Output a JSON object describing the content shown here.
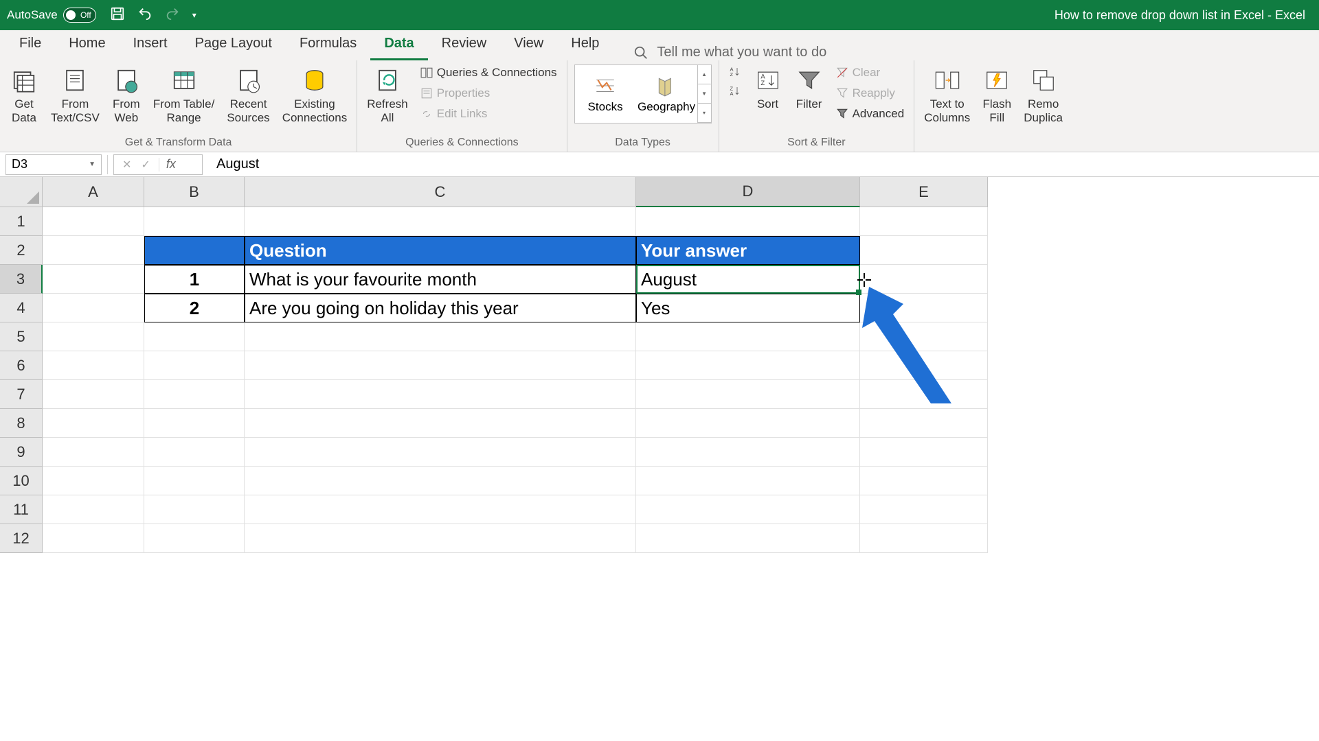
{
  "titlebar": {
    "autosave_label": "AutoSave",
    "autosave_state": "Off",
    "doc_title": "How to remove drop down list in Excel  -  Excel"
  },
  "tabs": {
    "file": "File",
    "home": "Home",
    "insert": "Insert",
    "page_layout": "Page Layout",
    "formulas": "Formulas",
    "data": "Data",
    "review": "Review",
    "view": "View",
    "help": "Help",
    "tellme": "Tell me what you want to do"
  },
  "ribbon": {
    "get_transform": {
      "label": "Get & Transform Data",
      "get_data": "Get\nData",
      "from_textcsv": "From\nText/CSV",
      "from_web": "From\nWeb",
      "from_table": "From Table/\nRange",
      "recent_sources": "Recent\nSources",
      "existing_conn": "Existing\nConnections"
    },
    "queries": {
      "label": "Queries & Connections",
      "refresh_all": "Refresh\nAll",
      "queries_conn": "Queries & Connections",
      "properties": "Properties",
      "edit_links": "Edit Links"
    },
    "data_types": {
      "label": "Data Types",
      "stocks": "Stocks",
      "geography": "Geography"
    },
    "sort_filter": {
      "label": "Sort & Filter",
      "sort": "Sort",
      "filter": "Filter",
      "clear": "Clear",
      "reapply": "Reapply",
      "advanced": "Advanced"
    },
    "data_tools": {
      "text_to_cols": "Text to\nColumns",
      "flash_fill": "Flash\nFill",
      "remove_dup": "Remo\nDuplica"
    }
  },
  "formula_bar": {
    "cell_ref": "D3",
    "value": "August"
  },
  "columns": [
    "A",
    "B",
    "C",
    "D",
    "E"
  ],
  "rows": [
    "1",
    "2",
    "3",
    "4",
    "5",
    "6",
    "7",
    "8",
    "9",
    "10",
    "11",
    "12"
  ],
  "table": {
    "header_b": "",
    "header_c": "Question",
    "header_d": "Your answer",
    "r1_num": "1",
    "r1_q": "What is your favourite month",
    "r1_a": "August",
    "r2_num": "2",
    "r2_q": "Are you going on holiday this year",
    "r2_a": "Yes"
  },
  "col_widths": {
    "A": 148,
    "B": 146,
    "C": 570,
    "D": 326,
    "E": 186
  }
}
